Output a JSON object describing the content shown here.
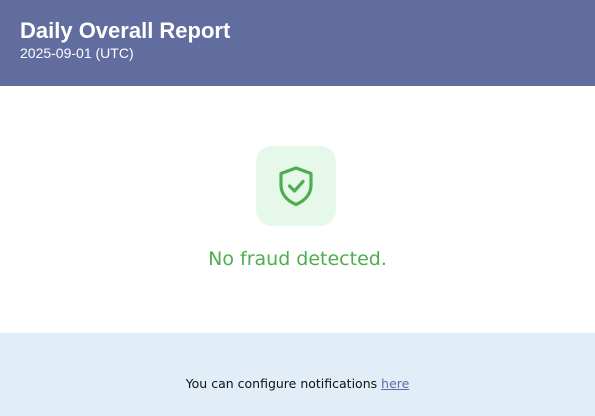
{
  "header": {
    "title": "Daily Overall Report",
    "date": "2025-09-01 (UTC)",
    "background_color": "#626d9f"
  },
  "main": {
    "icon": "shield-check-icon",
    "status_text": "No fraud detected.",
    "status_color": "#4cae4f",
    "icon_background_color": "#e6f8e9"
  },
  "footer": {
    "text": "You can configure notifications",
    "link_label": "here",
    "background_color": "#e1edf7"
  }
}
